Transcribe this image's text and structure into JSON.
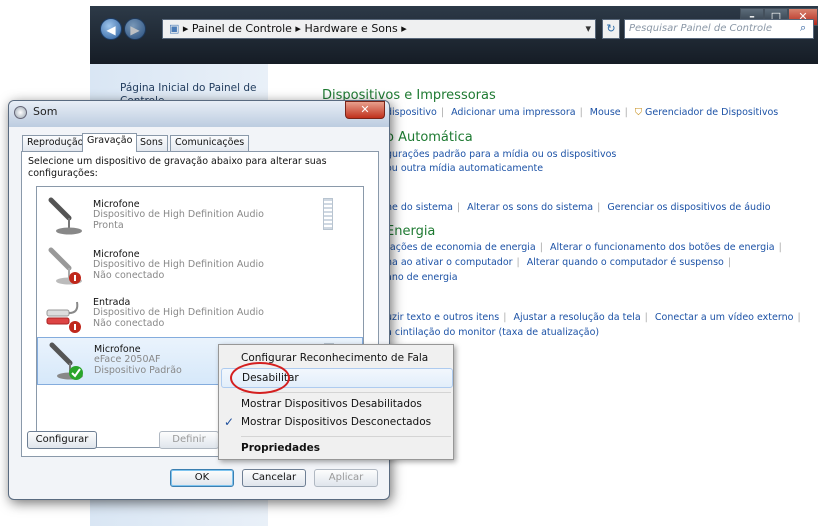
{
  "explorer": {
    "breadcrumb": [
      "Painel de Controle",
      "Hardware e Sons"
    ],
    "search_placeholder": "Pesquisar Painel de Controle",
    "home_link": "Página Inicial do Painel de Controle",
    "sections": [
      {
        "title": "Dispositivos e Impressoras",
        "links": [
          "dispositivo",
          "Adicionar uma impressora",
          "Mouse",
          "Gerenciador de Dispositivos"
        ]
      },
      {
        "title": "o Automática",
        "links": [
          "gurações padrão para a mídia ou os dispositivos",
          "ou outra mídia automaticamente"
        ]
      },
      {
        "title": "",
        "links": [
          "ne do sistema",
          "Alterar os sons do sistema",
          "Gerenciar os dispositivos de áudio"
        ]
      },
      {
        "title": "Energia",
        "links": [
          "rações de economia de energia",
          "Alterar o funcionamento dos botões de energia",
          "ha ao ativar o computador",
          "Alterar quando o computador é suspenso",
          "ano de energia"
        ]
      },
      {
        "title": "",
        "links": [
          "uzir texto e outros itens",
          "Ajustar a resolução da tela",
          "Conectar a um vídeo externo",
          "a cintilação do monitor (taxa de atualização)"
        ]
      }
    ]
  },
  "dialog": {
    "title": "Som",
    "tabs": [
      "Reprodução",
      "Gravação",
      "Sons",
      "Comunicações"
    ],
    "instruction": "Selecione um dispositivo de gravação abaixo para alterar suas configurações:",
    "devices": [
      {
        "name": "Microfone",
        "desc": "Dispositivo de High Definition Audio",
        "status": "Pronta"
      },
      {
        "name": "Microfone",
        "desc": "Dispositivo de High Definition Audio",
        "status": "Não conectado"
      },
      {
        "name": "Entrada",
        "desc": "Dispositivo de High Definition Audio",
        "status": "Não conectado"
      },
      {
        "name": "Microfone",
        "desc": "eFace 2050AF",
        "status": "Dispositivo Padrão"
      }
    ],
    "buttons": {
      "configure": "Configurar",
      "set_default": "Definir",
      "ok": "OK",
      "cancel": "Cancelar",
      "apply": "Aplicar"
    }
  },
  "context_menu": {
    "items": [
      "Configurar Reconhecimento de Fala",
      "Desabilitar",
      "Mostrar Dispositivos Desabilitados",
      "Mostrar Dispositivos Desconectados",
      "Propriedades"
    ]
  },
  "colors": {
    "accent_link": "#1c52a6",
    "group_green": "#1e7a32",
    "highlight_ring": "#d42020"
  },
  "icons": [
    "back-icon",
    "forward-icon",
    "folder-icon",
    "search-icon",
    "refresh-icon",
    "microphone-icon",
    "jack-icon",
    "checkmark-icon",
    "shield-icon"
  ]
}
